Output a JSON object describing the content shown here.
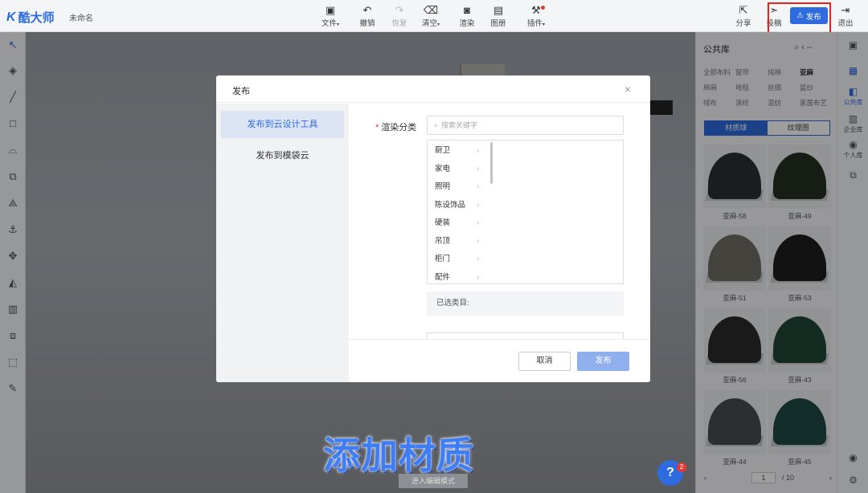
{
  "app": {
    "logo_text": "酷大师",
    "document_name": "未命名"
  },
  "toolbar": {
    "items": [
      {
        "id": "file",
        "label": "文件",
        "icon": "file-icon",
        "glyph": "▣",
        "dropdown": true,
        "enabled": true
      },
      {
        "id": "undo",
        "label": "撤销",
        "icon": "undo-icon",
        "glyph": "↶",
        "enabled": true
      },
      {
        "id": "redo",
        "label": "恢复",
        "icon": "redo-icon",
        "glyph": "↷",
        "enabled": false
      },
      {
        "id": "clear",
        "label": "清空",
        "icon": "eraser-icon",
        "glyph": "⌫",
        "dropdown": true,
        "enabled": true
      },
      {
        "id": "render",
        "label": "渲染",
        "icon": "render-icon",
        "glyph": "◙",
        "enabled": true
      },
      {
        "id": "drawing",
        "label": "图册",
        "icon": "image-icon",
        "glyph": "▤",
        "enabled": true
      },
      {
        "id": "plugin",
        "label": "插件",
        "icon": "hammer-icon",
        "glyph": "⚒",
        "dropdown": true,
        "enabled": true,
        "badge_dot": true
      }
    ],
    "share_label": "分享",
    "submit_label": "投稿",
    "publish_label": "发布",
    "exit_label": "退出"
  },
  "library": {
    "title": "公共库",
    "categories": [
      "全部布料",
      "窗帘",
      "纯棉",
      "亚麻",
      "棉麻",
      "地毯",
      "丝绸",
      "篮纱",
      "绒布",
      "涤纶",
      "混纺",
      "家居布艺"
    ],
    "active_category": "亚麻",
    "tabs": [
      "材质球",
      "纹理图"
    ],
    "active_tab": "材质球",
    "materials": [
      {
        "name": "亚麻-58",
        "color": "#2c2e30"
      },
      {
        "name": "亚麻-49",
        "color": "#253021"
      },
      {
        "name": "亚麻-51",
        "color": "#6e6d64"
      },
      {
        "name": "亚麻-53",
        "color": "#1d1e20"
      },
      {
        "name": "亚麻-56",
        "color": "#2a2b2d"
      },
      {
        "name": "亚麻-43",
        "color": "#1f4634"
      },
      {
        "name": "亚麻-44",
        "color": "#4a4b4d"
      },
      {
        "name": "亚麻-45",
        "color": "#1d4a44"
      }
    ],
    "pager": {
      "current": "1",
      "total": "/ 10"
    }
  },
  "rightbar": {
    "public_library": "公共库",
    "enterprise_library": "企业库",
    "personal_library": "个人库"
  },
  "modal": {
    "title": "发布",
    "side_items": [
      "发布到云设计工具",
      "发布到模袋云"
    ],
    "active_side": 0,
    "field_label": "渲染分类",
    "search_placeholder": "搜索关键字",
    "categories": [
      "厨卫",
      "家电",
      "照明",
      "陈设饰品",
      "硬装",
      "吊顶",
      "柜门",
      "配件"
    ],
    "selected_label": "已选类目:",
    "cancel_label": "取消",
    "publish_label": "发布"
  },
  "caption": "添加材质",
  "help": {
    "glyph": "?",
    "badge": "2"
  },
  "bottom_chip": "进入编辑模式"
}
